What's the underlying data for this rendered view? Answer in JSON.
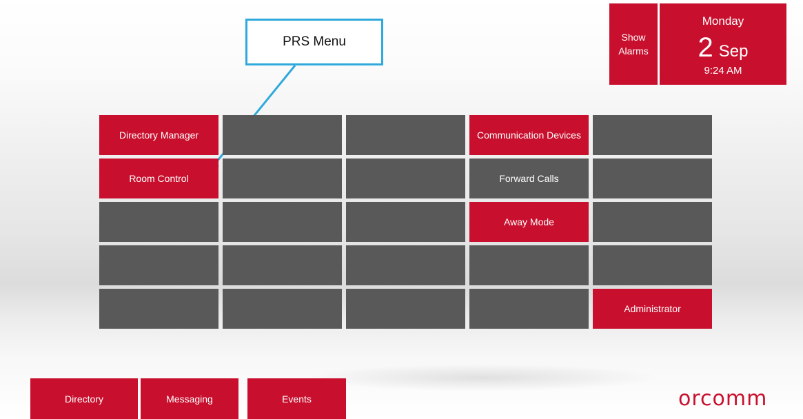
{
  "callout": {
    "label": "PRS Menu"
  },
  "header": {
    "alarms_label_line1": "Show",
    "alarms_label_line2": "Alarms",
    "weekday": "Monday",
    "day": "2",
    "month": "Sep",
    "time": "9:24 AM"
  },
  "menu": {
    "rows": [
      [
        "Directory Manager",
        "",
        "",
        "Communication Devices",
        ""
      ],
      [
        "Room Control",
        "",
        "",
        "Forward Calls",
        ""
      ],
      [
        "",
        "",
        "",
        "Away Mode",
        ""
      ],
      [
        "",
        "",
        "",
        "",
        ""
      ],
      [
        "",
        "",
        "",
        "",
        "Administrator"
      ]
    ],
    "active": [
      [
        true,
        false,
        false,
        true,
        false
      ],
      [
        true,
        false,
        false,
        false,
        false
      ],
      [
        false,
        false,
        false,
        true,
        false
      ],
      [
        false,
        false,
        false,
        false,
        false
      ],
      [
        false,
        false,
        false,
        false,
        true
      ]
    ]
  },
  "nav": {
    "directory_label": "Directory",
    "messaging_label": "Messaging",
    "events_label": "Events"
  },
  "brand": {
    "logo_text": "orcomm",
    "color": "#c8102e",
    "tile_gray": "#595959",
    "callout_color": "#2fa9dc"
  }
}
